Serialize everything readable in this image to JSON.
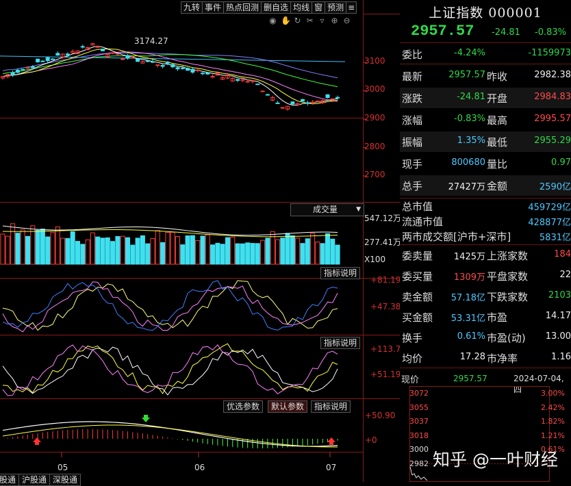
{
  "toolbar": {
    "buttons": [
      "九转",
      "事件",
      "热点回测",
      "删自选",
      "均线",
      "窗",
      "预测"
    ],
    "menu_icon": "hamburger-icon",
    "tools": [
      "eye-icon",
      "hand-icon",
      "refresh-icon",
      "scissors-icon",
      "cup-icon",
      "zoom-in-icon",
      "zoom-out-icon"
    ]
  },
  "main_chart": {
    "peak_label": "3174.27",
    "price_axis": [
      "3100",
      "3000",
      "2900",
      "2800",
      "2700"
    ],
    "colors": {
      "up": "#ff3c3c",
      "down": "#3fe0f0",
      "ma5": "#ffffff",
      "ma10": "#ffff40",
      "ma20": "#ff80ff",
      "ma60": "#40ff40",
      "ma120": "#8080ff",
      "ma250": "#40c0ff"
    }
  },
  "volume_panel": {
    "dropdown_label": "成交量",
    "axis": [
      "547.12万",
      "277.41万",
      "X100"
    ]
  },
  "kdj_panel": {
    "button": "指标说明",
    "axis": [
      "+81.19",
      "+47.38"
    ]
  },
  "rsi_panel": {
    "button": "指标说明",
    "axis": [
      "+113.7",
      "+51.19"
    ]
  },
  "macd_panel": {
    "buttons": [
      "优选参数",
      "默认参数",
      "指标说明"
    ],
    "axis": [
      "+50.90",
      "+0"
    ]
  },
  "date_axis": [
    "05",
    "06",
    "07"
  ],
  "bottom_tabs": [
    "港股通",
    "沪股通",
    "深股通"
  ],
  "quote": {
    "title": "上证指数 000001",
    "price": "2957.57",
    "change": "-24.81",
    "change_pct": "-0.83%",
    "weibi_label": "委比",
    "weibi_pct": "-4.24%",
    "weibi_val": "-1159973",
    "rows": [
      {
        "l1": "最新",
        "v1": "2957.57",
        "c1": "green",
        "l2": "昨收",
        "v2": "2982.38",
        "c2": "white"
      },
      {
        "l1": "涨跌",
        "v1": "-24.81",
        "c1": "green",
        "l2": "开盘",
        "v2": "2984.83",
        "c2": "red"
      },
      {
        "l1": "涨幅",
        "v1": "-0.83%",
        "c1": "green",
        "l2": "最高",
        "v2": "2995.57",
        "c2": "red"
      },
      {
        "l1": "振幅",
        "v1": "1.35%",
        "c1": "cyan",
        "l2": "最低",
        "v2": "2955.29",
        "c2": "green"
      },
      {
        "l1": "现手",
        "v1": "800680",
        "c1": "cyan",
        "l2": "量比",
        "v2": "0.97",
        "c2": "green"
      },
      {
        "l1": "总手",
        "v1": "27427万",
        "c1": "white",
        "l2": "金额",
        "v2": "2590亿",
        "c2": "cyan"
      }
    ],
    "market": [
      {
        "l": "总市值",
        "v": "459729亿"
      },
      {
        "l": "流通市值",
        "v": "428877亿"
      },
      {
        "l": "两市成交额[沪市+深市]",
        "v": "5831亿"
      }
    ],
    "rows2": [
      {
        "l1": "委卖量",
        "v1": "1425万",
        "c1": "white",
        "l2": "上涨家数",
        "v2": "184",
        "c2": "red"
      },
      {
        "l1": "委买量",
        "v1": "1309万",
        "c1": "red",
        "l2": "平盘家数",
        "v2": "22",
        "c2": "white"
      },
      {
        "l1": "卖金额",
        "v1": "57.18亿",
        "c1": "cyan",
        "l2": "下跌家数",
        "v2": "2103",
        "c2": "green"
      },
      {
        "l1": "买金额",
        "v1": "53.31亿",
        "c1": "cyan",
        "l2": "市盈",
        "v2": "14.17",
        "c2": "white"
      },
      {
        "l1": "换手",
        "v1": "0.61%",
        "c1": "cyan",
        "l2": "市盈(动)",
        "v2": "13.00",
        "c2": "white"
      },
      {
        "l1": "均价",
        "v1": "17.28",
        "c1": "white",
        "l2": "市净率",
        "v2": "1.16",
        "c2": "white"
      }
    ],
    "now_label": "现价",
    "now_price": "2957.57",
    "date": "2024-07-04,四"
  },
  "mini_chart": {
    "left_axis": [
      "3072",
      "3055",
      "3037",
      "3018",
      "3000",
      "2982"
    ],
    "right_axis": [
      "3.00%",
      "2.42%",
      "1.82%",
      "1.21%",
      "0.61%"
    ]
  },
  "watermark": "知乎 @一叶财经"
}
